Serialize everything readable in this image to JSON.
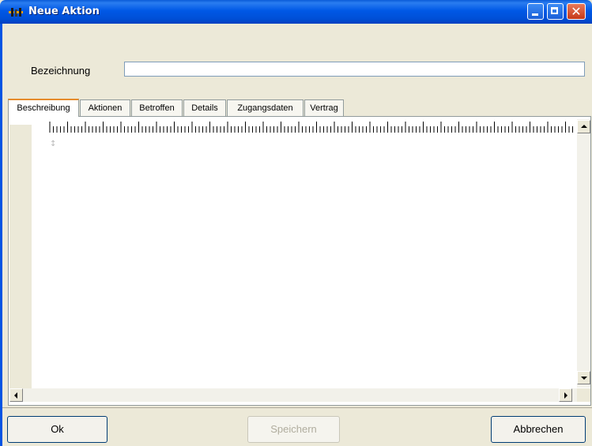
{
  "window": {
    "title": "Neue Aktion",
    "icon": "app-icon",
    "controls": [
      "minimize-icon",
      "maximize-icon",
      "close-icon"
    ],
    "close_glyph": "✕"
  },
  "form": {
    "name_label": "Bezeichnung",
    "name_value": ""
  },
  "tabs": [
    {
      "label": "Beschreibung",
      "active": true
    },
    {
      "label": "Aktionen",
      "active": false
    },
    {
      "label": "Betroffen",
      "active": false
    },
    {
      "label": "Details",
      "active": false
    },
    {
      "label": "Zugangsdaten",
      "active": false
    },
    {
      "label": "Vertrag",
      "active": false
    }
  ],
  "editor": {
    "content": "",
    "cursor_glyph": "↕"
  },
  "buttons": {
    "ok": "Ok",
    "save": "Speichern",
    "cancel": "Abbrechen"
  },
  "colors": {
    "titlebar": "#0058e6",
    "active_tab_accent": "#e68b2c",
    "face": "#ece9d8"
  }
}
